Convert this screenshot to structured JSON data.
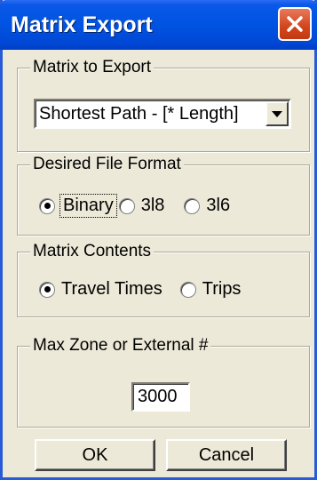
{
  "window": {
    "title": "Matrix Export"
  },
  "groups": {
    "matrix_to_export": {
      "label": "Matrix to Export",
      "selected": "Shortest Path - [* Length]"
    },
    "file_format": {
      "label": "Desired File Format",
      "options": [
        "Binary",
        "3l8",
        "3l6"
      ],
      "selected": "Binary"
    },
    "matrix_contents": {
      "label": "Matrix Contents",
      "options": [
        "Travel Times",
        "Trips"
      ],
      "selected": "Travel Times"
    },
    "max_zone": {
      "label": "Max Zone or External #",
      "value": "3000"
    }
  },
  "buttons": {
    "ok": "OK",
    "cancel": "Cancel"
  },
  "colors": {
    "titlebar": "#0053e1",
    "close": "#d2451b",
    "dialog_bg": "#ece9d8"
  }
}
